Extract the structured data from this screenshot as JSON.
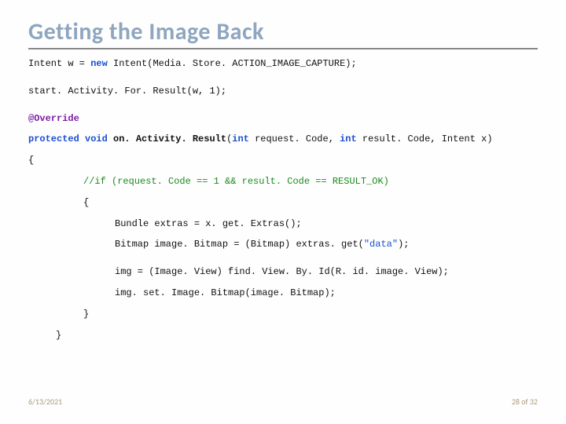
{
  "title": "Getting the Image Back",
  "code": {
    "l1_a": "Intent w = ",
    "l1_b": "new",
    "l1_c": " Intent(Media. Store. ACTION_IMAGE_CAPTURE);",
    "l2": "start. Activity. For. Result(w, 1);",
    "l3": "@Override",
    "l4_a": "protected",
    "l4_b": " ",
    "l4_c": "void",
    "l4_d": " ",
    "l4_e": "on. Activity. Result",
    "l4_f": "(",
    "l4_g": "int",
    "l4_h": " request. Code, ",
    "l4_i": "int",
    "l4_j": " result. Code, Intent x)",
    "l5": "{",
    "l6_a": "//if",
    "l6_b": " (request. Code == 1 && result. Code == RESULT_OK)",
    "l7": "{",
    "l8_a": "Bundle extras = x. get. Extras();",
    "l9_a": "Bitmap image. Bitmap = (Bitmap) extras. get(",
    "l9_b": "\"data\"",
    "l9_c": ");",
    "l10": "img = (Image. View) find. View. By. Id(R. id. image. View);",
    "l11": "img. set. Image. Bitmap(image. Bitmap);",
    "l12": "}",
    "l13": "}"
  },
  "footer": {
    "date": "6/13/2021",
    "page_current": "28",
    "page_sep": " of ",
    "page_total": "32"
  }
}
